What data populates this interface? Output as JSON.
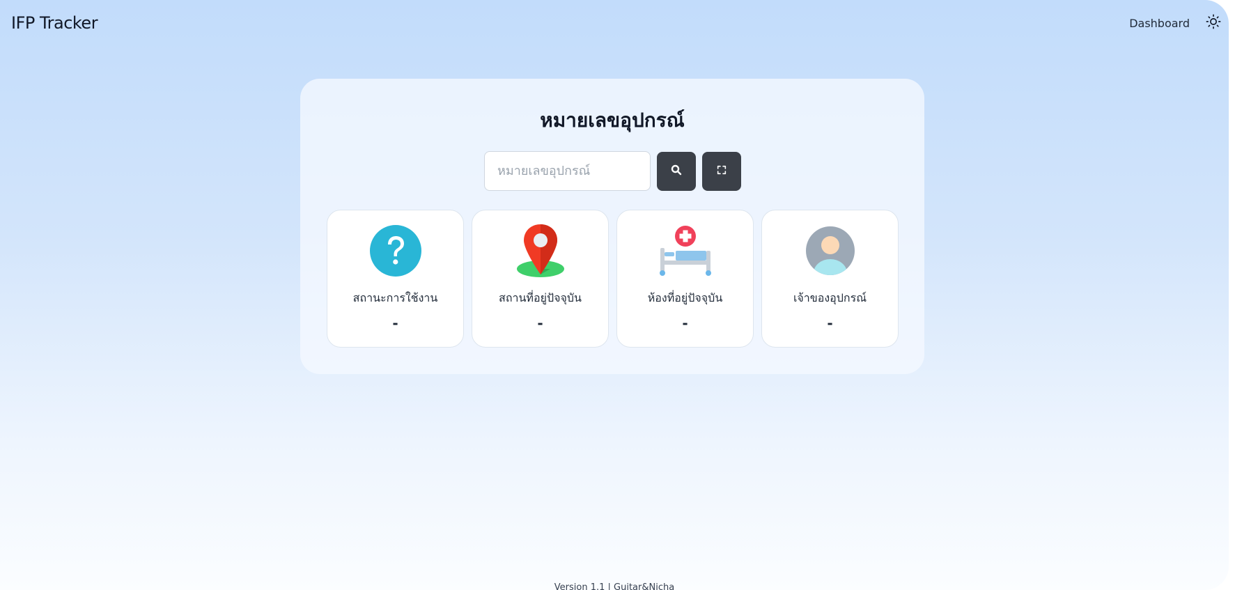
{
  "header": {
    "brand": "IFP Tracker",
    "nav_link": "Dashboard",
    "theme_icon": "sun-icon"
  },
  "search_card": {
    "title": "หมายเลขอุปกรณ์",
    "input_value": "",
    "input_placeholder": "หมายเลขอุปกรณ์",
    "search_icon": "search-icon",
    "scan_icon": "scan-icon"
  },
  "tiles": [
    {
      "icon": "question-icon",
      "label": "สถานะการใช้งาน",
      "value": "-"
    },
    {
      "icon": "location-pin-icon",
      "label": "สถานที่อยู่ปัจจุบัน",
      "value": "-"
    },
    {
      "icon": "hospital-bed-icon",
      "label": "ห้องที่อยู่ปัจจุบัน",
      "value": "-"
    },
    {
      "icon": "user-avatar-icon",
      "label": "เจ้าของอุปกรณ์",
      "value": "-"
    }
  ],
  "footer": {
    "text": "Version 1.1 | Guitar&Nicha"
  },
  "colors": {
    "background_top": "#c2dcfb",
    "background_bottom": "#fbfdff",
    "button_dark": "#3b4048",
    "question_icon": "#29b6d6",
    "pin_red": "#f03a24",
    "pin_base_green": "#3fcf6a",
    "medical_red": "#f0415a",
    "bed_blue": "#8ec5ec",
    "avatar_grey": "#9ca8b5"
  }
}
